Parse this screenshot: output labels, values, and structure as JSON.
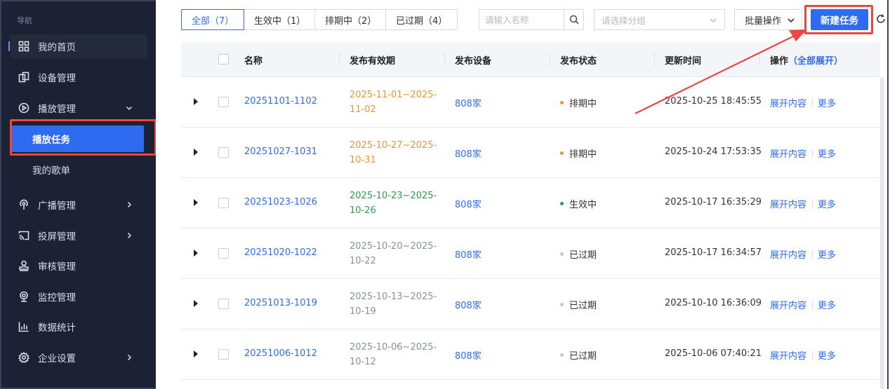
{
  "sidebar": {
    "heading": "导航",
    "items": [
      {
        "label": "我的首页",
        "icon": "grid-icon"
      },
      {
        "label": "设备管理",
        "icon": "device-icon"
      },
      {
        "label": "播放管理",
        "icon": "play-icon"
      },
      {
        "label": "广播管理",
        "icon": "broadcast-icon"
      },
      {
        "label": "投屏管理",
        "icon": "cast-icon"
      },
      {
        "label": "审核管理",
        "icon": "stamp-icon"
      },
      {
        "label": "监控管理",
        "icon": "camera-icon"
      },
      {
        "label": "数据统计",
        "icon": "bar-chart-icon"
      },
      {
        "label": "企业设置",
        "icon": "gear-icon"
      }
    ],
    "sub_items": [
      {
        "label": "播放任务",
        "active": true
      },
      {
        "label": "我的歌单",
        "active": false
      }
    ]
  },
  "toolbar": {
    "tabs": [
      "全部（7）",
      "生效中（1）",
      "排期中（2）",
      "已过期（4）"
    ],
    "search_placeholder": "请输入名称",
    "group_placeholder": "请选择分组",
    "batch_label": "批量操作",
    "new_task_label": "新建任务"
  },
  "table": {
    "headers": {
      "name": "名称",
      "period": "发布有效期",
      "device": "发布设备",
      "status": "发布状态",
      "updated": "更新时间",
      "actions": "操作",
      "expand_all": "（全部展开）"
    },
    "rows": [
      {
        "name": "20251101-1102",
        "period_1": "2025-11-01~2025-",
        "period_2": "11-02",
        "period_color": "#e8962e",
        "device": "808家",
        "status": "排期中",
        "status_color": "#e8962e",
        "updated": "2025-10-25 18:45:55",
        "expand": "展开内容",
        "more": "更多"
      },
      {
        "name": "20251027-1031",
        "period_1": "2025-10-27~2025-",
        "period_2": "10-31",
        "period_color": "#e8962e",
        "device": "808家",
        "status": "排期中",
        "status_color": "#e8962e",
        "updated": "2025-10-24 17:53:35",
        "expand": "展开内容",
        "more": "更多"
      },
      {
        "name": "20251023-1026",
        "period_1": "2025-10-23~2025-",
        "period_2": "10-26",
        "period_color": "#2e9a4e",
        "device": "808家",
        "status": "生效中",
        "status_color": "#2e9a4e",
        "updated": "2025-10-17 16:35:29",
        "expand": "展开内容",
        "more": "更多"
      },
      {
        "name": "20251020-1022",
        "period_1": "2025-10-20~2025-",
        "period_2": "10-22",
        "period_color": "#8a8f99",
        "device": "808家",
        "status": "已过期",
        "status_color": "#c4c7cc",
        "updated": "2025-10-17 16:34:57",
        "expand": "展开内容",
        "more": "更多"
      },
      {
        "name": "20251013-1019",
        "period_1": "2025-10-13~2025-",
        "period_2": "10-19",
        "period_color": "#8a8f99",
        "device": "808家",
        "status": "已过期",
        "status_color": "#c4c7cc",
        "updated": "2025-10-10 16:36:09",
        "expand": "展开内容",
        "more": "更多"
      },
      {
        "name": "20251006-1012",
        "period_1": "2025-10-06~2025-",
        "period_2": "10-12",
        "period_color": "#8a8f99",
        "device": "808家",
        "status": "已过期",
        "status_color": "#c4c7cc",
        "updated": "2025-10-06 07:40:21",
        "expand": "展开内容",
        "more": "更多"
      }
    ]
  },
  "colors": {
    "accent": "#2f6bf0",
    "sidebar_bg": "#1c2233",
    "highlight": "#e9473f"
  }
}
